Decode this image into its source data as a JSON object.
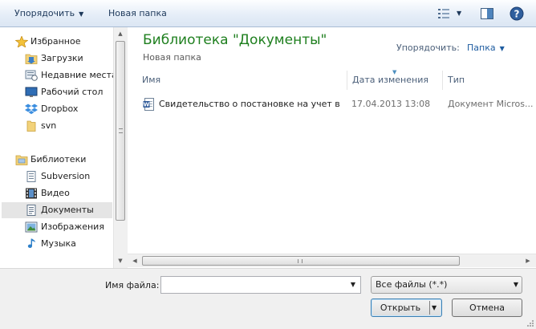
{
  "toolbar": {
    "organize_label": "Упорядочить",
    "new_folder_label": "Новая папка"
  },
  "nav": {
    "favorites_label": "Избранное",
    "favorites": [
      {
        "label": "Загрузки",
        "icon": "downloads-folder-icon"
      },
      {
        "label": "Недавние места",
        "icon": "recent-places-icon"
      },
      {
        "label": "Рабочий стол",
        "icon": "desktop-icon"
      },
      {
        "label": "Dropbox",
        "icon": "dropbox-icon"
      },
      {
        "label": "svn",
        "icon": "folder-icon"
      }
    ],
    "libraries_label": "Библиотеки",
    "libraries": [
      {
        "label": "Subversion",
        "icon": "document-library-icon"
      },
      {
        "label": "Видео",
        "icon": "video-library-icon"
      },
      {
        "label": "Документы",
        "icon": "documents-library-icon",
        "selected": true
      },
      {
        "label": "Изображения",
        "icon": "pictures-library-icon"
      },
      {
        "label": "Музыка",
        "icon": "music-library-icon"
      }
    ]
  },
  "main": {
    "library_title": "Библиотека \"Документы\"",
    "library_subtitle": "Новая папка",
    "arrange_label": "Упорядочить:",
    "arrange_value": "Папка",
    "columns": {
      "name": "Имя",
      "date": "Дата изменения",
      "type": "Тип"
    },
    "files": [
      {
        "name": "Свидетельство о постановке на учет в ...",
        "date": "17.04.2013 13:08",
        "type": "Документ Micros...",
        "icon": "word-document-icon"
      }
    ]
  },
  "bottom": {
    "filename_label": "Имя файла:",
    "filename_value": "",
    "filter_value": "Все файлы (*.*)",
    "open_label": "Открыть",
    "cancel_label": "Отмена"
  },
  "colors": {
    "title_green": "#1e7f1e",
    "link_blue": "#1e5ca0",
    "selection_gray": "#e5e5e5",
    "toolbar_top": "#fdfeff",
    "toolbar_bottom": "#dbe6f3"
  }
}
